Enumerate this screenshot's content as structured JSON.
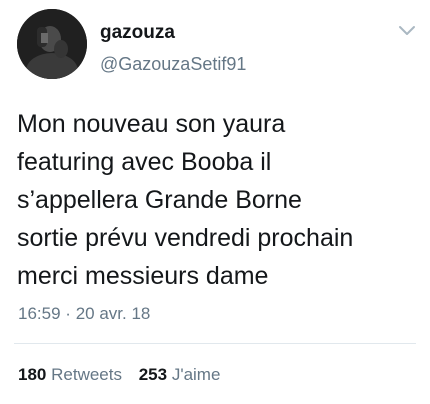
{
  "user": {
    "display_name": "gazouza",
    "handle": "@GazouzaSetif91"
  },
  "icons": {
    "avatar": "avatar-photo",
    "menu": "chevron-down-icon"
  },
  "tweet": {
    "text": "Mon nouveau son yaura\nfeaturing avec Booba il\ns’appellera Grande Borne\nsortie prévu vendredi prochain\nmerci messieurs dame",
    "time": "16:59",
    "separator": "·",
    "date": "20 avr. 18"
  },
  "stats": {
    "retweets_count": "180",
    "retweets_label": "Retweets",
    "likes_count": "253",
    "likes_label": "J'aime"
  },
  "colors": {
    "text": "#14171a",
    "secondary": "#657786",
    "divider": "#e1e8ed"
  }
}
